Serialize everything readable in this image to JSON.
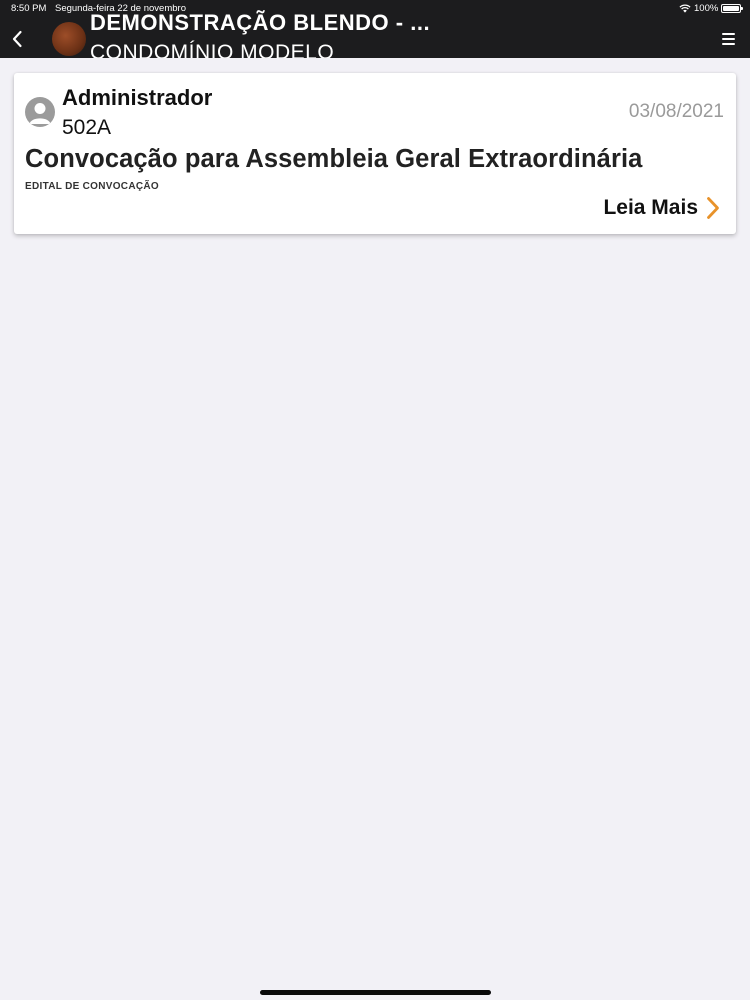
{
  "status_bar": {
    "time": "8:50 PM",
    "date": "Segunda-feira 22 de novembro",
    "battery": "100%",
    "icons": [
      "wifi-icon",
      "battery-icon"
    ]
  },
  "nav": {
    "title": "DEMONSTRAÇÃO BLENDO - ...",
    "subtitle": "CONDOMÍNIO MODELO",
    "back_icon": "chevron-left-icon",
    "menu_icon": "hamburger-menu-icon"
  },
  "post": {
    "author": "Administrador",
    "unit": "502A",
    "date": "03/08/2021",
    "title": "Convocação para Assembleia Geral Extraordinária",
    "category": "EDITAL DE CONVOCAÇÃO",
    "read_more": "Leia Mais",
    "avatar_icon": "user-avatar-icon",
    "read_more_icon": "chevron-right-icon"
  },
  "colors": {
    "nav_background": "#1c1c1e",
    "page_background": "#f2f1f6",
    "accent": "#e8922a",
    "date_text": "#9a9a9a"
  }
}
